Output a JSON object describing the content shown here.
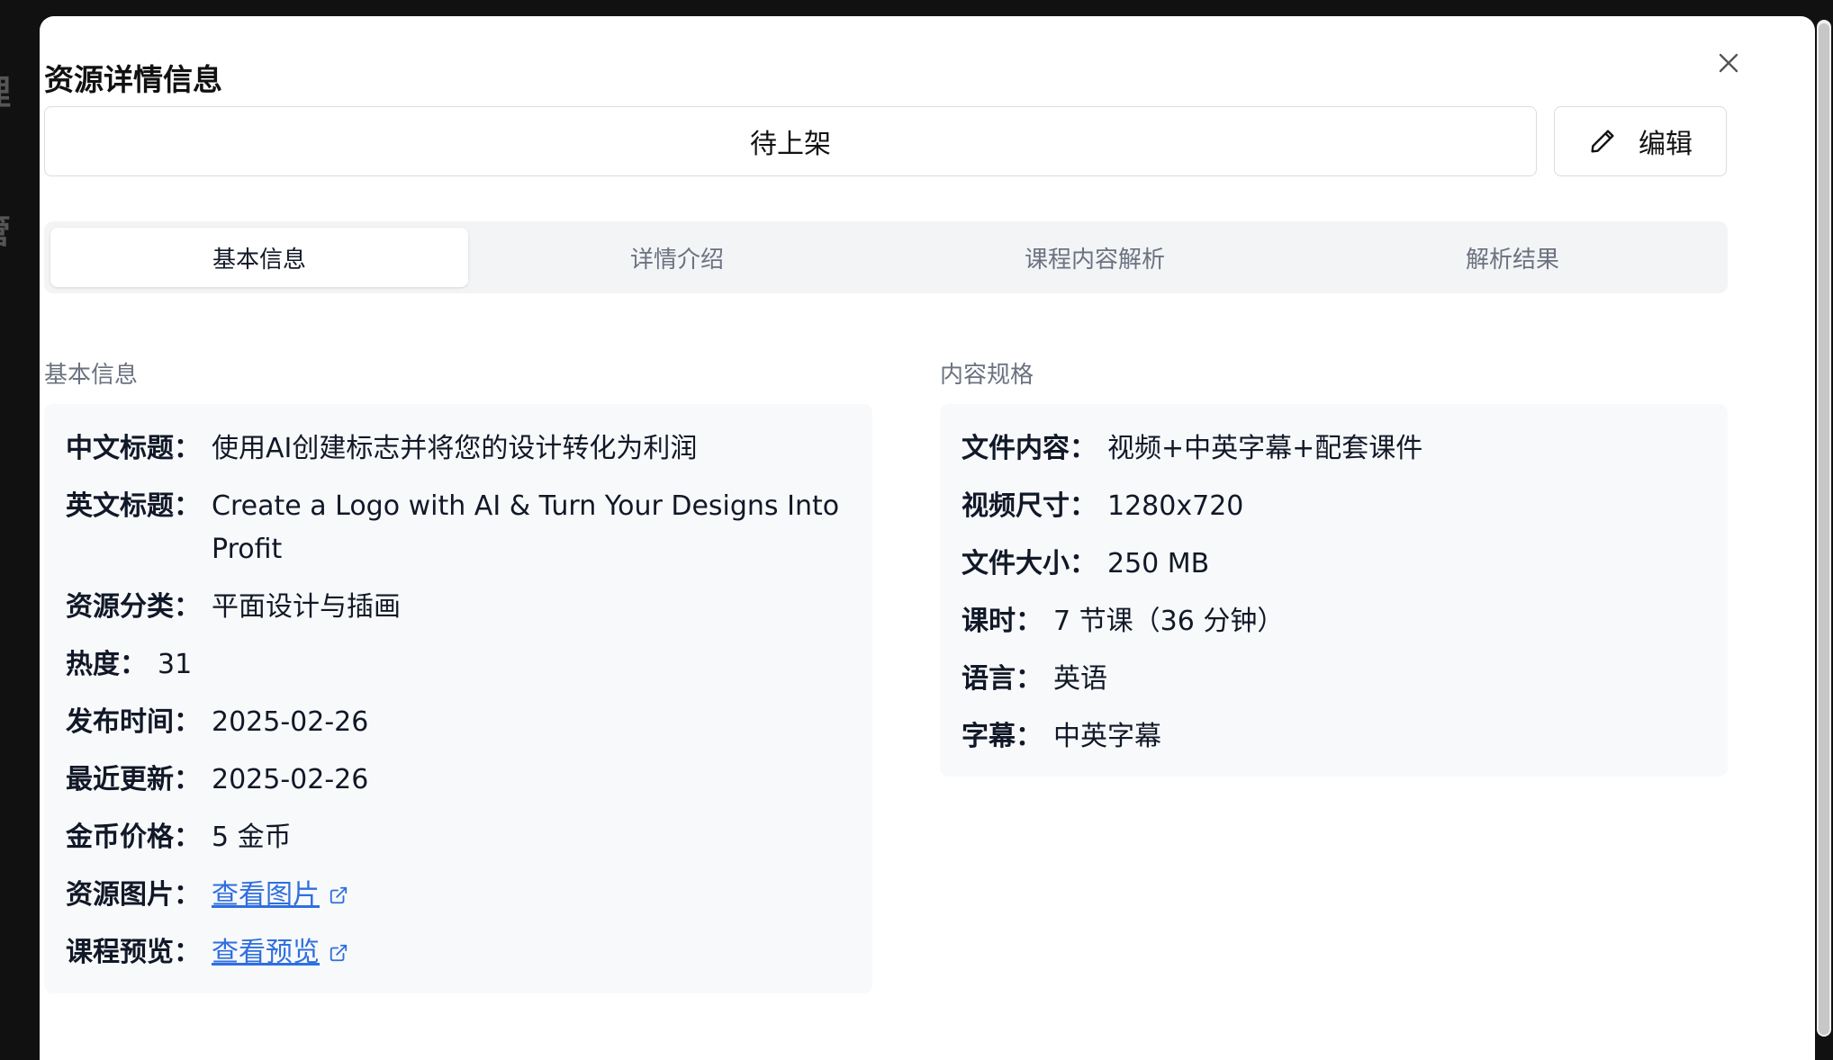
{
  "backdrop": {
    "text_1": "理",
    "text_2": "管"
  },
  "modal": {
    "title": "资源详情信息",
    "status": "待上架",
    "edit_label": "编辑"
  },
  "tabs": [
    {
      "label": "基本信息"
    },
    {
      "label": "详情介绍"
    },
    {
      "label": "课程内容解析"
    },
    {
      "label": "解析结果"
    }
  ],
  "basic_info": {
    "heading": "基本信息",
    "fields": [
      {
        "label": "中文标题：",
        "value": "使用AI创建标志并将您的设计转化为利润"
      },
      {
        "label": "英文标题：",
        "value": "Create a Logo with AI & Turn Your Designs Into Profit"
      },
      {
        "label": "资源分类：",
        "value": "平面设计与插画"
      },
      {
        "label": "热度：",
        "value": "31"
      },
      {
        "label": "发布时间：",
        "value": "2025-02-26"
      },
      {
        "label": "最近更新：",
        "value": "2025-02-26"
      },
      {
        "label": "金币价格：",
        "value": "5 金币"
      },
      {
        "label": "资源图片：",
        "link": "查看图片"
      },
      {
        "label": "课程预览：",
        "link": "查看预览"
      }
    ]
  },
  "content_spec": {
    "heading": "内容规格",
    "fields": [
      {
        "label": "文件内容：",
        "value": "视频+中英字幕+配套课件"
      },
      {
        "label": "视频尺寸：",
        "value": "1280x720"
      },
      {
        "label": "文件大小：",
        "value": "250 MB"
      },
      {
        "label": "课时：",
        "value": "7 节课（36 分钟）"
      },
      {
        "label": "语言：",
        "value": "英语"
      },
      {
        "label": "字幕：",
        "value": "中英字幕"
      }
    ]
  },
  "colors": {
    "link": "#2f6fde",
    "panel_bg": "#f8f9fb",
    "tab_bg": "#f3f4f6"
  },
  "icons": [
    "close-icon",
    "pencil-icon",
    "external-link-icon"
  ]
}
